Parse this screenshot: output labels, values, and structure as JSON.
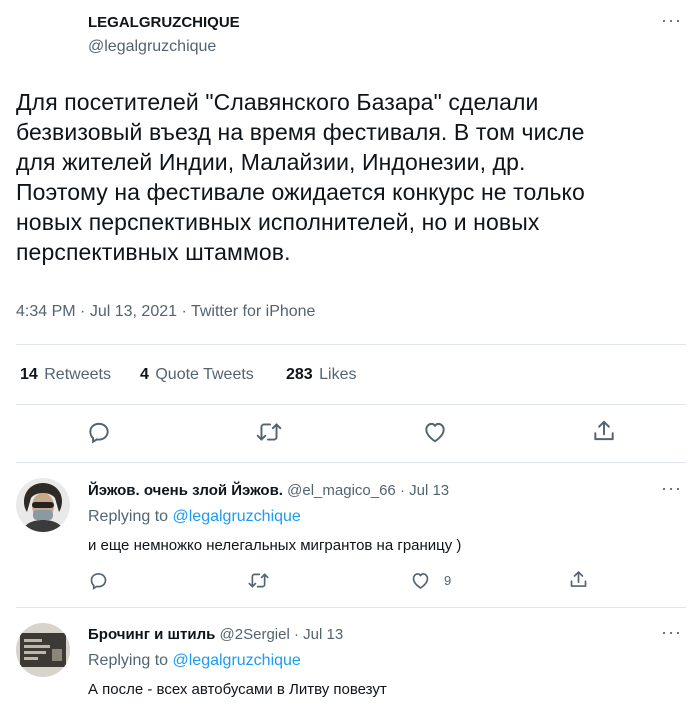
{
  "tweet": {
    "display_name": "LEGALGRUZCHIQUE",
    "handle": "@legalgruzchique",
    "text_lines": [
      "Для посетителей \"Славянского Базара\" сделали",
      "безвизовый въезд на время фестиваля. В том числе",
      "для жителей Индии, Малайзии, Индонезии, др.",
      "Поэтому на фестивале ожидается конкурс не только",
      "новых перспективных исполнителей, но и новых",
      "перспективных штаммов."
    ],
    "time": "4:34 PM",
    "date": "Jul 13, 2021",
    "source": "Twitter for iPhone",
    "separator": "·"
  },
  "stats": {
    "retweets_count": "14",
    "retweets_label": "Retweets",
    "quotes_count": "4",
    "quotes_label": "Quote Tweets",
    "likes_count": "283",
    "likes_label": "Likes"
  },
  "more_label": "···",
  "replies": [
    {
      "name": "Йэжов. очень злой Йэжов.",
      "handle": "@el_magico_66",
      "separator": "·",
      "date": "Jul 13",
      "replying_prefix": "Replying to",
      "replying_handle": "@legalgruzchique",
      "text": "и еще немножко нелегальных мигрантов на границу )",
      "like_count": "9"
    },
    {
      "name": "Брочинг и штиль",
      "handle": "@2Sergiel",
      "separator": "·",
      "date": "Jul 13",
      "replying_prefix": "Replying to",
      "replying_handle": "@legalgruzchique",
      "text": "А после - всех автобусами в Литву повезут"
    }
  ],
  "colors": {
    "text": "#0f1419",
    "muted": "#536471",
    "link": "#1d9bf0",
    "divider": "#dfe5ea"
  }
}
